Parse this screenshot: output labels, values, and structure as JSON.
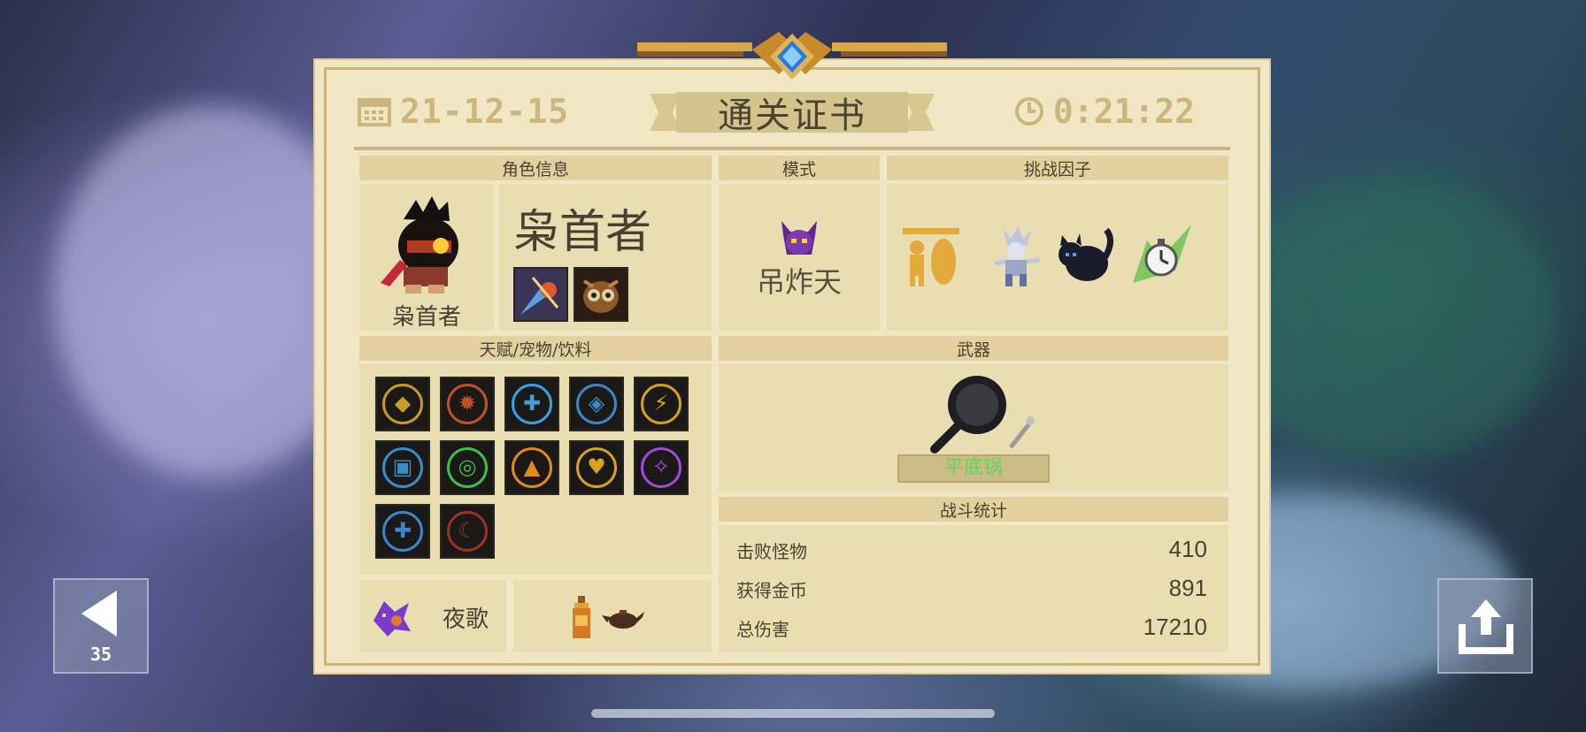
{
  "header": {
    "date": "21-12-15",
    "title": "通关证书",
    "time": "0:21:22"
  },
  "character": {
    "section_label": "角色信息",
    "class_name": "枭首者",
    "portrait_caption": "枭首者",
    "skill_icons": [
      "comet-skill-icon",
      "owl-skill-icon"
    ]
  },
  "mode": {
    "section_label": "模式",
    "name": "吊炸天",
    "icon": "horned-demon-icon"
  },
  "challenge": {
    "section_label": "挑战因子",
    "factors": [
      "statue-sword-icon",
      "jester-icon",
      "black-cat-icon",
      "stopwatch-icon"
    ]
  },
  "talents": {
    "section_label": "天赋/宠物/饮料",
    "icons": [
      {
        "name": "gold-shield-talent-icon",
        "ring": "#c99b24"
      },
      {
        "name": "fire-talent-icon",
        "ring": "#c0522a"
      },
      {
        "name": "blue-shield-talent-icon",
        "ring": "#3aa0e0"
      },
      {
        "name": "broken-shield-talent-icon",
        "ring": "#3a86c8"
      },
      {
        "name": "lightning-talent-icon",
        "ring": "#d6a21a"
      },
      {
        "name": "chest-talent-icon",
        "ring": "#3a8ec8"
      },
      {
        "name": "green-shield-talent-icon",
        "ring": "#3fbf4a"
      },
      {
        "name": "flame-shield-talent-icon",
        "ring": "#e08a1a"
      },
      {
        "name": "heart-talent-icon",
        "ring": "#d8a21a"
      },
      {
        "name": "purple-shield-talent-icon",
        "ring": "#a14ad6"
      },
      {
        "name": "brain-talent-icon",
        "ring": "#3a86c8"
      },
      {
        "name": "blade-talent-icon",
        "ring": "#a03020"
      }
    ],
    "pet_name": "夜歌",
    "pet_icon": "purple-fish-pet-icon",
    "drink_icons": [
      "bottle-icon",
      "teapot-icon"
    ]
  },
  "weapon": {
    "section_label": "武器",
    "name": "平底锅",
    "icon": "frying-pan-icon",
    "name_color": "#5cd85a"
  },
  "battle_stats": {
    "section_label": "战斗统计",
    "rows": [
      {
        "label": "击败怪物",
        "value": "410"
      },
      {
        "label": "获得金币",
        "value": "891"
      },
      {
        "label": "总伤害",
        "value": "17210"
      }
    ]
  },
  "back_button": {
    "countdown": "35",
    "icon": "back-arrow-icon"
  },
  "share_button": {
    "icon": "share-icon"
  }
}
